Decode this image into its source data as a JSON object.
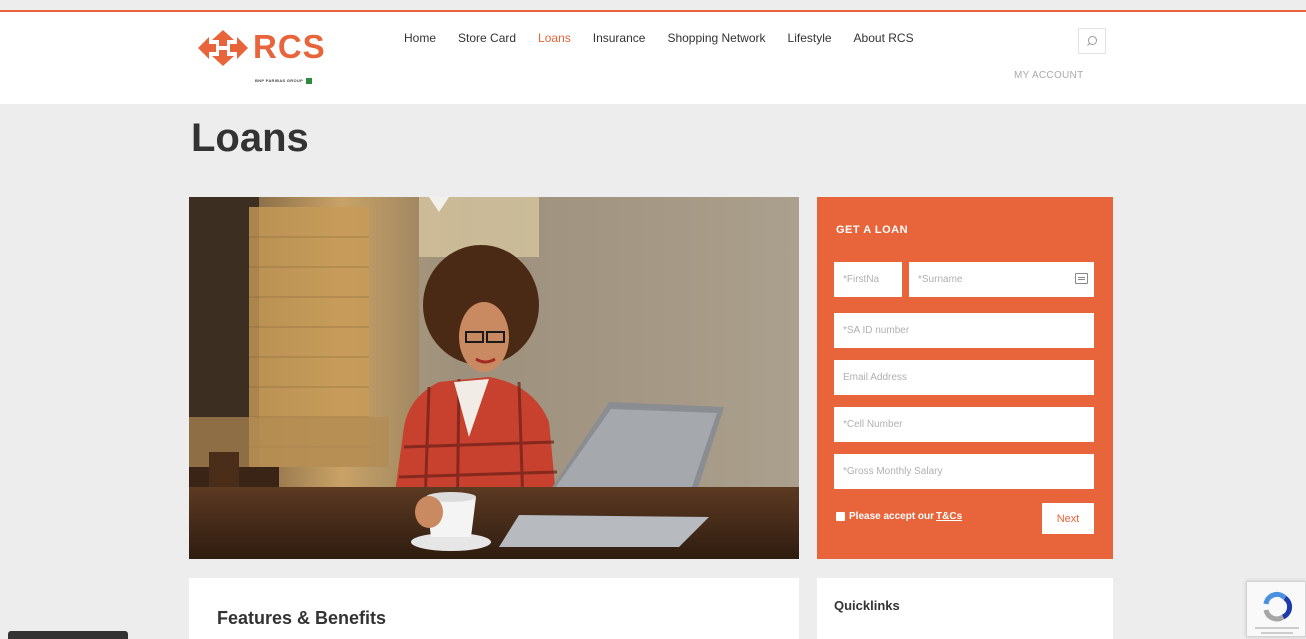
{
  "header": {
    "logo": {
      "text": "RCS",
      "subtext": "BNP PARIBAS GROUP"
    },
    "nav": [
      {
        "label": "Home",
        "active": false
      },
      {
        "label": "Store Card",
        "active": false
      },
      {
        "label": "Loans",
        "active": true
      },
      {
        "label": "Insurance",
        "active": false
      },
      {
        "label": "Shopping Network",
        "active": false
      },
      {
        "label": "Lifestyle",
        "active": false
      },
      {
        "label": "About RCS",
        "active": false
      }
    ],
    "search_icon": "search-icon",
    "my_account": "MY ACCOUNT"
  },
  "page": {
    "title": "Loans"
  },
  "hero": {
    "icon": "hero-photo"
  },
  "loan_form": {
    "title": "GET A LOAN",
    "fields": {
      "first_name": {
        "placeholder": "*FirstNa",
        "value": ""
      },
      "surname": {
        "placeholder": "*Surname",
        "value": ""
      },
      "id_number": {
        "placeholder": "*SA ID number",
        "value": ""
      },
      "email": {
        "placeholder": "Email Address",
        "value": ""
      },
      "cell": {
        "placeholder": "*Cell Number",
        "value": ""
      },
      "salary": {
        "placeholder": "*Gross Monthly Salary",
        "value": ""
      }
    },
    "accept_text": "Please accept our",
    "accept_link": "T&Cs",
    "next_label": "Next"
  },
  "features": {
    "title": "Features & Benefits"
  },
  "quicklinks": {
    "title": "Quicklinks"
  },
  "colors": {
    "accent": "#e8643a",
    "background": "#ededed",
    "header": "#ffffff"
  }
}
